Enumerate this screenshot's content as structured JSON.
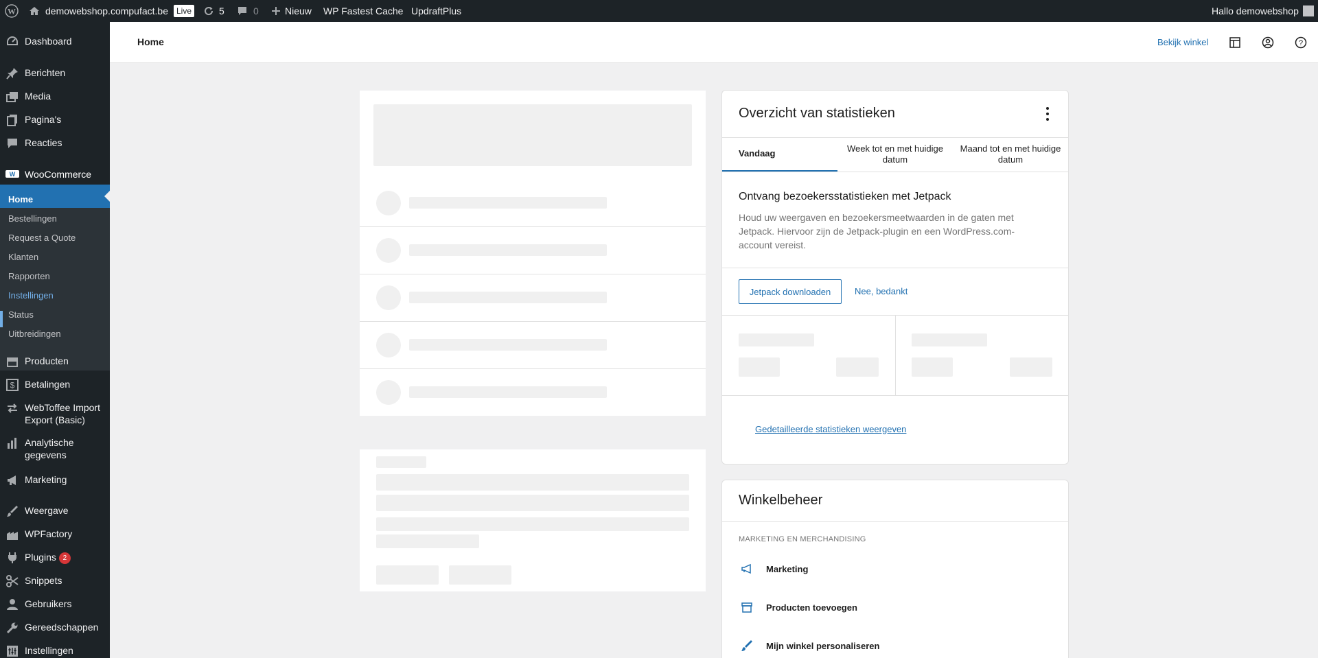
{
  "adminbar": {
    "site_name": "demowebshop.compufact.be",
    "live_label": "Live",
    "updates_count": "5",
    "comments_count": "0",
    "new_label": "Nieuw",
    "fastest_cache_label": "WP Fastest Cache",
    "updraft_label": "UpdraftPlus",
    "greeting": "Hallo demowebshop"
  },
  "sidebar": {
    "dashboard": "Dashboard",
    "berichten": "Berichten",
    "media": "Media",
    "paginas": "Pagina's",
    "reacties": "Reacties",
    "woocommerce": "WooCommerce",
    "submenu": {
      "home": "Home",
      "bestellingen": "Bestellingen",
      "request_quote": "Request a Quote",
      "klanten": "Klanten",
      "rapporten": "Rapporten",
      "instellingen": "Instellingen",
      "status": "Status",
      "uitbreidingen": "Uitbreidingen"
    },
    "producten": "Producten",
    "betalingen": "Betalingen",
    "webtoffee_line1": "WebToffee Import",
    "webtoffee_line2": "Export (Basic)",
    "analytics_line1": "Analytische",
    "analytics_line2": "gegevens",
    "marketing": "Marketing",
    "weergave": "Weergave",
    "wpfactory": "WPFactory",
    "plugins": "Plugins",
    "plugins_badge": "2",
    "snippets": "Snippets",
    "gebruikers": "Gebruikers",
    "gereedschappen": "Gereedschappen",
    "instellingen": "Instellingen"
  },
  "header": {
    "title": "Home",
    "view_store": "Bekijk winkel"
  },
  "stats": {
    "title": "Overzicht van statistieken",
    "tabs": [
      "Vandaag",
      "Week tot en met huidige datum",
      "Maand tot en met huidige datum"
    ],
    "jetpack_title": "Ontvang bezoekersstatistieken met Jetpack",
    "jetpack_desc": "Houd uw weergaven en bezoekersmeetwaarden in de gaten met Jetpack. Hiervoor zijn de Jetpack-plugin en een WordPress.com-account vereist.",
    "download_button": "Jetpack downloaden",
    "no_thanks": "Nee, bedankt",
    "detail_link": "Gedetailleerde statistieken weergeven"
  },
  "store_management": {
    "title": "Winkelbeheer",
    "section": "MARKETING EN MERCHANDISING",
    "items": [
      "Marketing",
      "Producten toevoegen",
      "Mijn winkel personaliseren"
    ]
  },
  "icons": [
    "wordpress-logo",
    "home",
    "refresh",
    "comment",
    "plus",
    "dashboard",
    "pin",
    "media",
    "page",
    "comment",
    "woo",
    "archive",
    "dollar",
    "arrows",
    "bar-chart",
    "megaphone",
    "brush",
    "factory",
    "plug",
    "scissors",
    "user",
    "wrench",
    "settings",
    "layout",
    "user-circle",
    "help"
  ],
  "colors": {
    "admin_bar": "#1d2327",
    "accent": "#2271b1",
    "submenu_bg": "#2c3338",
    "badge": "#d63638"
  }
}
